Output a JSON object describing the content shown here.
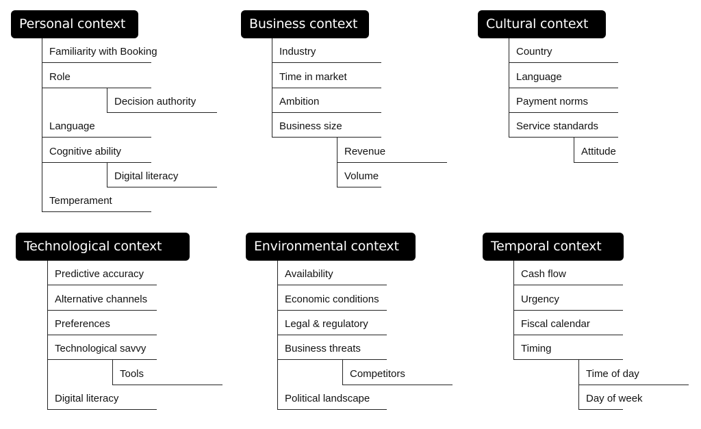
{
  "groups": [
    {
      "title": "Personal context",
      "items": [
        {
          "label": "Familiarity with Booking"
        },
        {
          "label": "Role",
          "children": [
            {
              "label": "Decision authority"
            }
          ]
        },
        {
          "label": "Language"
        },
        {
          "label": "Cognitive ability",
          "children": [
            {
              "label": "Digital literacy"
            }
          ]
        },
        {
          "label": "Temperament"
        }
      ]
    },
    {
      "title": "Business context",
      "items": [
        {
          "label": "Industry"
        },
        {
          "label": "Time in market"
        },
        {
          "label": "Ambition"
        },
        {
          "label": "Business size",
          "children": [
            {
              "label": "Revenue"
            },
            {
              "label": "Volume"
            }
          ]
        }
      ]
    },
    {
      "title": "Cultural context",
      "items": [
        {
          "label": "Country"
        },
        {
          "label": "Language"
        },
        {
          "label": "Payment norms"
        },
        {
          "label": "Service standards",
          "children": [
            {
              "label": "Attitude"
            }
          ]
        }
      ]
    },
    {
      "title": "Technological context",
      "items": [
        {
          "label": "Predictive accuracy"
        },
        {
          "label": "Alternative channels"
        },
        {
          "label": "Preferences"
        },
        {
          "label": "Technological savvy",
          "children": [
            {
              "label": "Tools"
            }
          ]
        },
        {
          "label": "Digital literacy"
        }
      ]
    },
    {
      "title": "Environmental context",
      "items": [
        {
          "label": "Availability"
        },
        {
          "label": "Economic conditions"
        },
        {
          "label": "Legal & regulatory"
        },
        {
          "label": "Business threats",
          "children": [
            {
              "label": "Competitors"
            }
          ]
        },
        {
          "label": "Political landscape"
        }
      ]
    },
    {
      "title": "Temporal context",
      "items": [
        {
          "label": "Cash flow"
        },
        {
          "label": "Urgency"
        },
        {
          "label": "Fiscal calendar"
        },
        {
          "label": "Timing",
          "children": [
            {
              "label": "Time of day"
            },
            {
              "label": "Day of week"
            }
          ]
        }
      ]
    }
  ]
}
